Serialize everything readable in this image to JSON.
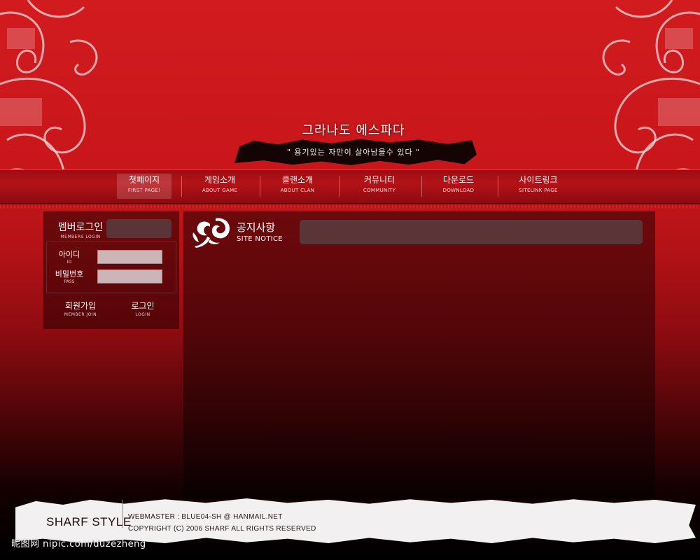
{
  "header": {
    "title": "그라나도 에스파다",
    "motto": "\" 용기있는 자만이 살아남을수 있다 \""
  },
  "nav": {
    "items": [
      {
        "ko": "첫페이지",
        "en": "FIRST PAGE!"
      },
      {
        "ko": "게임소개",
        "en": "ABOUT GAME"
      },
      {
        "ko": "클랜소개",
        "en": "ABOUT CLAN"
      },
      {
        "ko": "커뮤니티",
        "en": "COMMUNITY"
      },
      {
        "ko": "다운로드",
        "en": "DOWNLOAD"
      },
      {
        "ko": "사이트링크",
        "en": "SITELINK PAGE"
      }
    ]
  },
  "login": {
    "title_ko": "멤버로그인",
    "title_en": "MEMBERS LOGIN",
    "id_ko": "아이디",
    "id_en": "ID",
    "pass_ko": "비밀번호",
    "pass_en": "PASS",
    "join_ko": "회원가입",
    "join_en": "MEMBER JOIN",
    "login_ko": "로그인",
    "login_en": "LOGIN"
  },
  "notice": {
    "title_ko": "공지사항",
    "title_en": "SITE NOTICE"
  },
  "footer": {
    "brand": "SHARF STYLE",
    "webmaster": "WEBMASTER : BLUE04-SH @ HANMAIL.NET",
    "copyright": "COPYRIGHT (C) 2006 SHARF ALL RIGHTS RESERVED"
  },
  "watermark": "昵图网 nipic.com/duzezheng",
  "colors": {
    "primary_red": "#d11b1f",
    "nav_red": "#b31318",
    "panel_gray": "#5a3436",
    "footer_paper": "#f2f0f0"
  }
}
